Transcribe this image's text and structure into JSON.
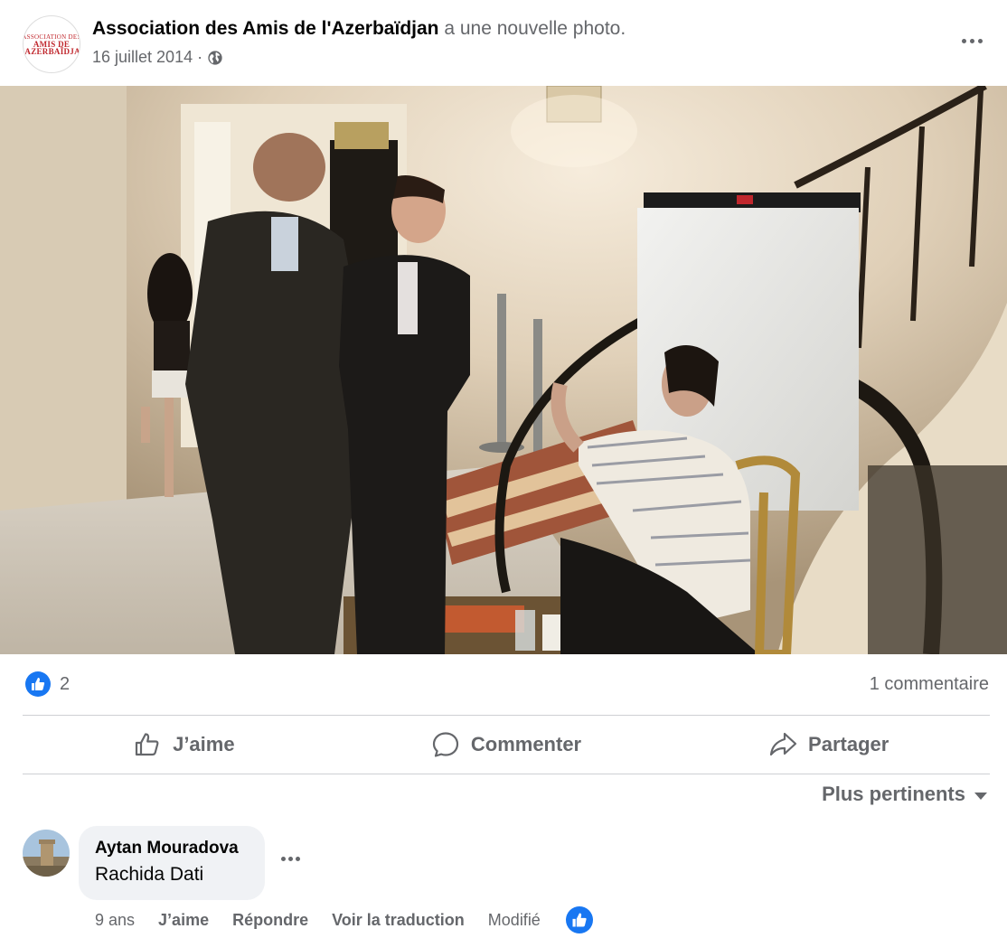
{
  "post": {
    "page_name": "Association des Amis de l'Azerbaïdjan",
    "action_text": "a une nouvelle photo.",
    "date": "16 juillet 2014",
    "date_separator": "·",
    "privacy_icon": "globe-icon",
    "avatar_logo": {
      "line1": "ASSOCIATION DES",
      "line2": "AMIS DE",
      "line3": "L'AZERBAÏDJAN"
    }
  },
  "photo": {
    "description_icon": "photo"
  },
  "reactions": {
    "like_count": "2",
    "comment_count": "1 commentaire",
    "like_color": "#1877f2"
  },
  "actions": {
    "like_label": "J’aime",
    "comment_label": "Commenter",
    "share_label": "Partager"
  },
  "sort": {
    "label": "Plus pertinents"
  },
  "comment": {
    "author": "Aytan Mouradova",
    "text": "Rachida Dati",
    "time": "9 ans",
    "like_label": "J’aime",
    "reply_label": "Répondre",
    "translate_label": "Voir la traduction",
    "edited_label": "Modifié"
  }
}
